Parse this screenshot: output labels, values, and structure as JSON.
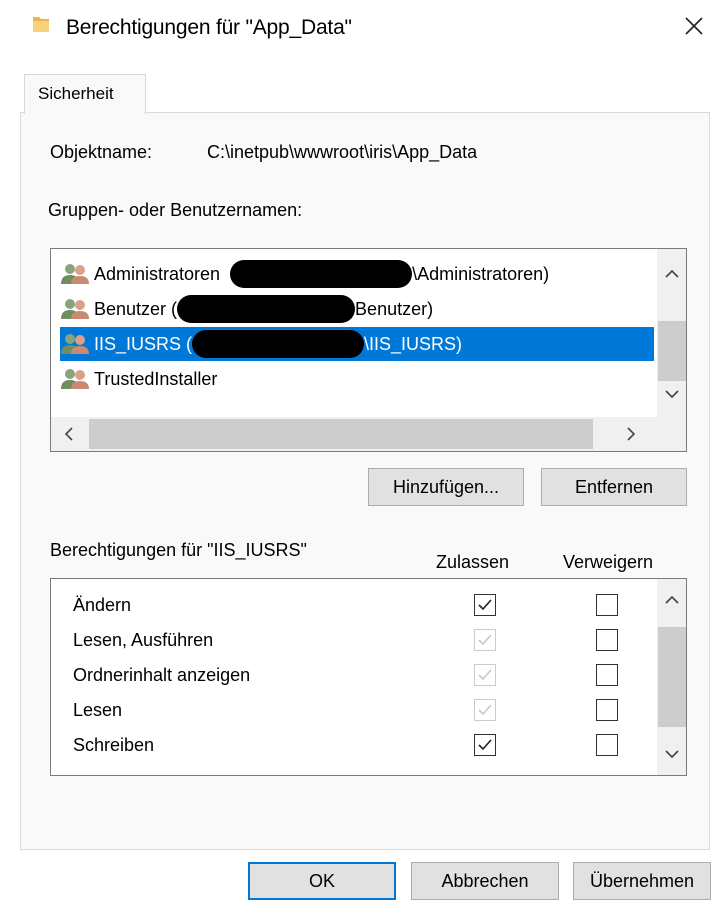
{
  "window": {
    "title": "Berechtigungen für \"App_Data\"",
    "folder_icon": "folder-icon",
    "close_icon": "close-icon"
  },
  "tabs": [
    {
      "label": "Sicherheit",
      "active": true
    }
  ],
  "object": {
    "label": "Objektname:",
    "value": "C:\\inetpub\\wwwroot\\iris\\App_Data"
  },
  "groups": {
    "label": "Gruppen- oder Benutzernamen:",
    "items": [
      {
        "prefix": "Administratoren",
        "open": "",
        "suffix": "\\Administratoren)",
        "redacted": true,
        "selected": false,
        "icon": "user-group-icon"
      },
      {
        "prefix": "Benutzer",
        "open": " (",
        "suffix": "Benutzer)",
        "redacted": true,
        "selected": false,
        "icon": "user-group-icon"
      },
      {
        "prefix": "IIS_IUSRS",
        "open": " (",
        "suffix": "\\IIS_IUSRS)",
        "redacted": true,
        "selected": true,
        "icon": "user-group-icon"
      },
      {
        "prefix": "TrustedInstaller",
        "open": "",
        "suffix": "",
        "redacted": false,
        "selected": false,
        "icon": "user-group-icon"
      }
    ]
  },
  "buttons": {
    "add": "Hinzufügen...",
    "remove": "Entfernen",
    "ok": "OK",
    "cancel": "Abbrechen",
    "apply": "Übernehmen"
  },
  "permissions": {
    "label": "Berechtigungen für \"IIS_IUSRS\"",
    "allow_header": "Zulassen",
    "deny_header": "Verweigern",
    "rows": [
      {
        "name": "Ändern",
        "allow": true,
        "allow_disabled": false,
        "deny": false
      },
      {
        "name": "Lesen, Ausführen",
        "allow": true,
        "allow_disabled": true,
        "deny": false
      },
      {
        "name": "Ordnerinhalt anzeigen",
        "allow": true,
        "allow_disabled": true,
        "deny": false
      },
      {
        "name": "Lesen",
        "allow": true,
        "allow_disabled": true,
        "deny": false
      },
      {
        "name": "Schreiben",
        "allow": true,
        "allow_disabled": false,
        "deny": false
      }
    ]
  },
  "colors": {
    "selection": "#0078d7",
    "panel": "#f9f9f9",
    "button": "#e1e1e1"
  }
}
